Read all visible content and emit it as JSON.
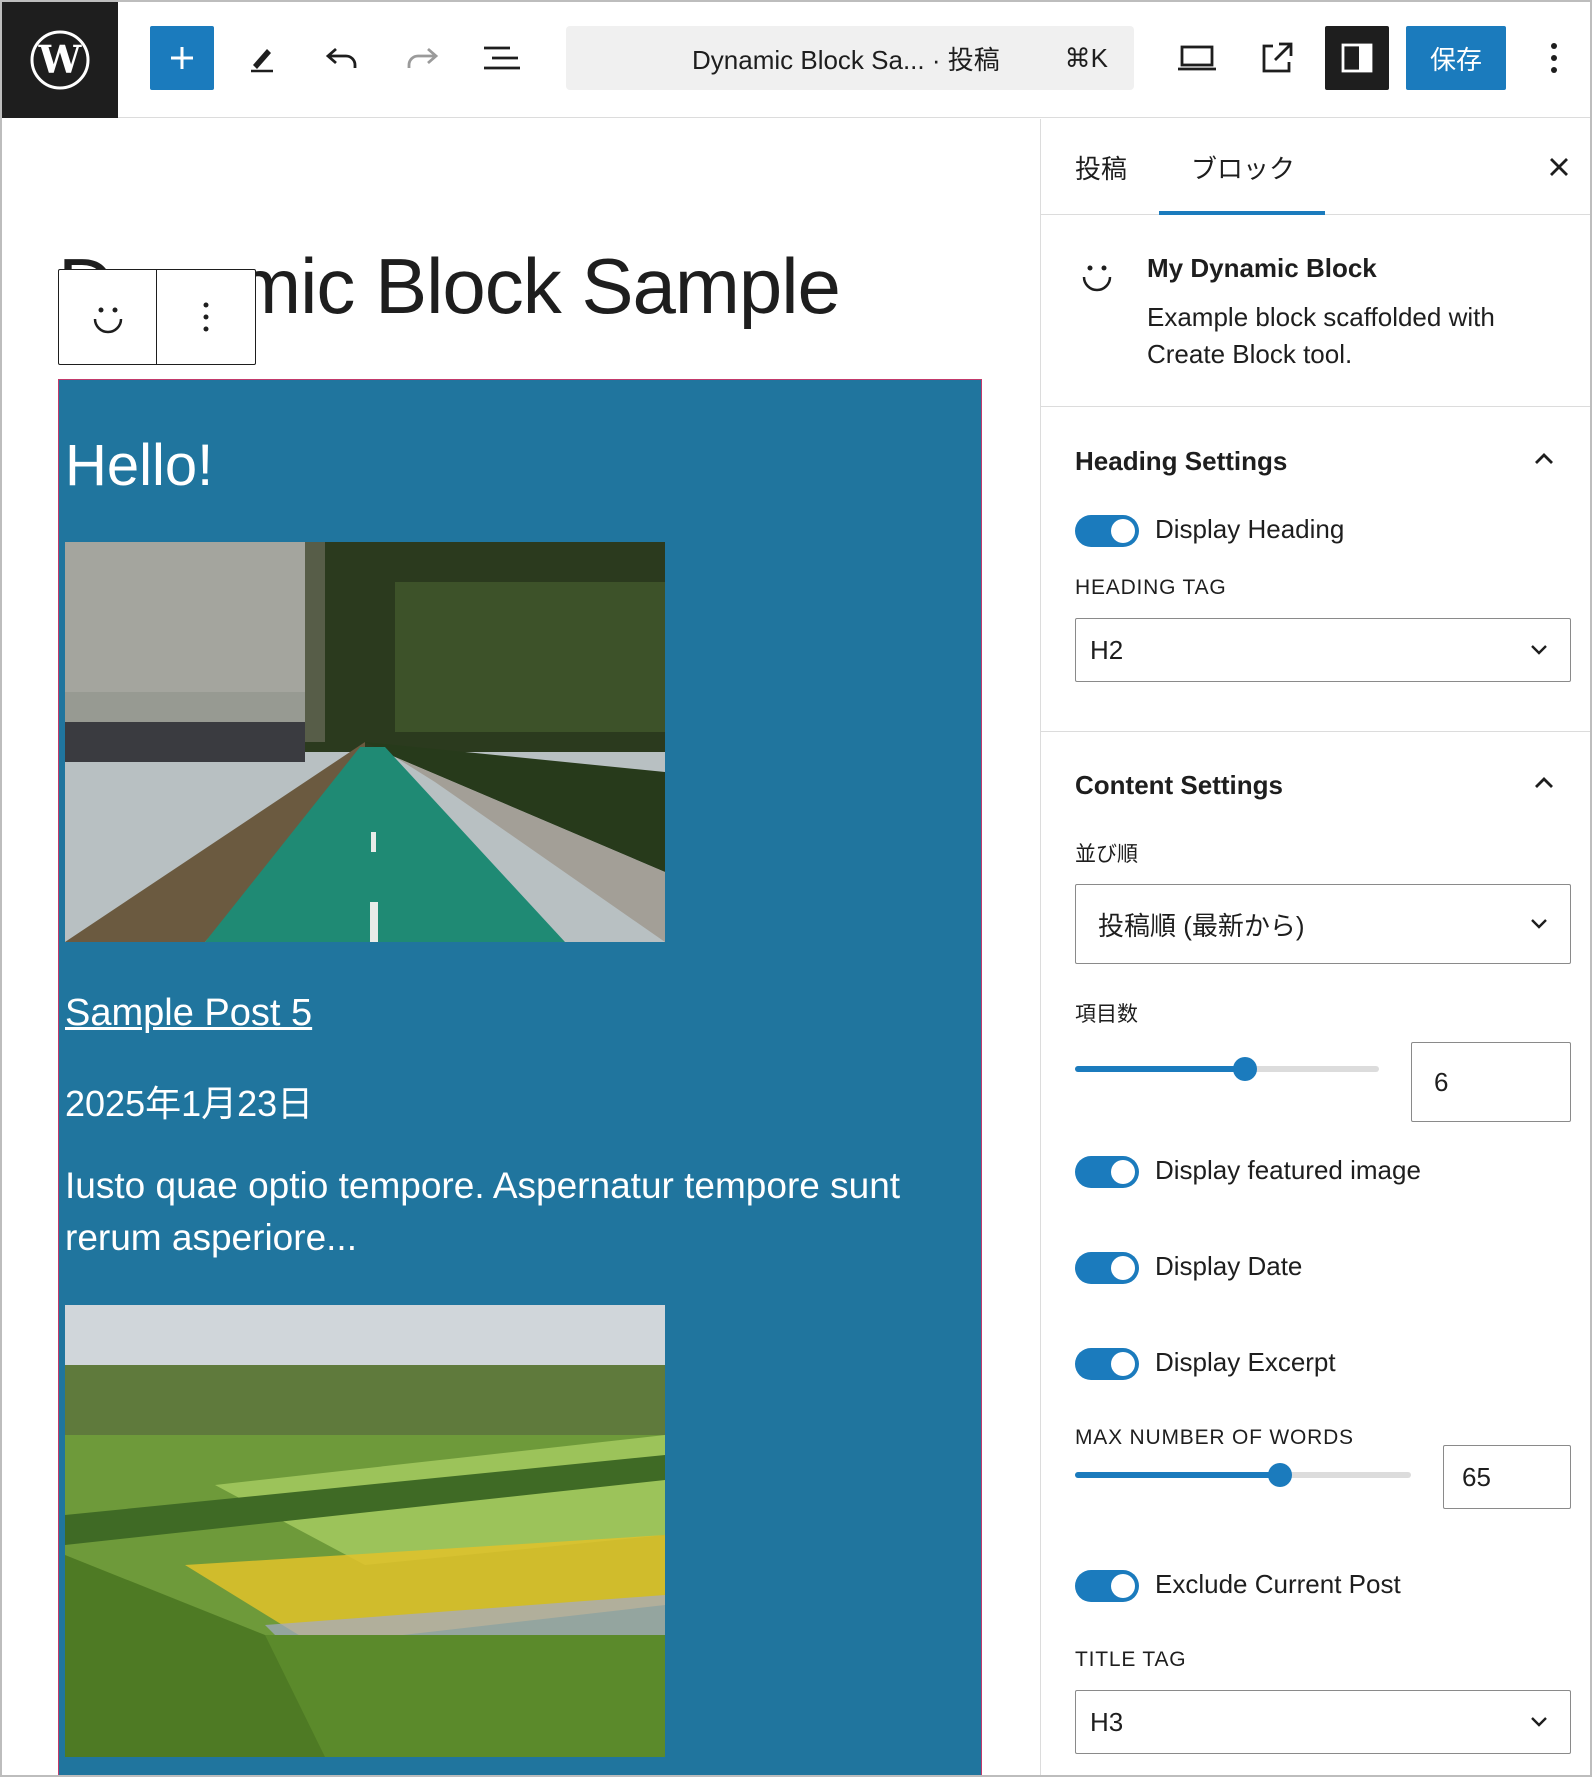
{
  "topbar": {
    "command_title": "Dynamic Block Sa... · 投稿",
    "command_shortcut": "⌘K",
    "save_label": "保存",
    "icons": [
      "wordpress-logo",
      "plus-icon",
      "pencil-icon",
      "undo-icon",
      "redo-icon",
      "list-view-icon",
      "desktop-view-icon",
      "external-link-icon",
      "sidebar-icon",
      "more-vertical-icon"
    ]
  },
  "canvas": {
    "post_title": "Dynamic Block Sample",
    "block": {
      "heading": "Hello!",
      "posts": [
        {
          "title": "Sample Post 5",
          "date": "2025年1月23日",
          "excerpt": "Iusto quae optio tempore. Aspernatur tempore sunt rerum asperiore..."
        }
      ]
    }
  },
  "sidebar": {
    "tabs": [
      "投稿",
      "ブロック"
    ],
    "active_tab": "ブロック",
    "block_card": {
      "name": "My Dynamic Block",
      "description": "Example block scaffolded with Create Block tool."
    },
    "heading_settings": {
      "title": "Heading Settings",
      "display_heading_label": "Display Heading",
      "heading_tag_label": "HEADING TAG",
      "heading_tag_value": "H2"
    },
    "content_settings": {
      "title": "Content Settings",
      "order_label": "並び順",
      "order_value": "投稿順 (最新から)",
      "count_label": "項目数",
      "count_value": "6",
      "count_fraction": 0.56,
      "display_featured_image_label": "Display featured image",
      "display_date_label": "Display Date",
      "display_excerpt_label": "Display Excerpt",
      "max_words_label": "MAX NUMBER OF WORDS",
      "max_words_value": "65",
      "max_words_fraction": 0.61,
      "exclude_current_label": "Exclude Current Post",
      "title_tag_label": "TITLE TAG",
      "title_tag_value": "H3"
    }
  },
  "colors": {
    "accent": "#1b7bbd",
    "block_background": "#20759e",
    "toolbar_dark": "#1e1e1e"
  }
}
